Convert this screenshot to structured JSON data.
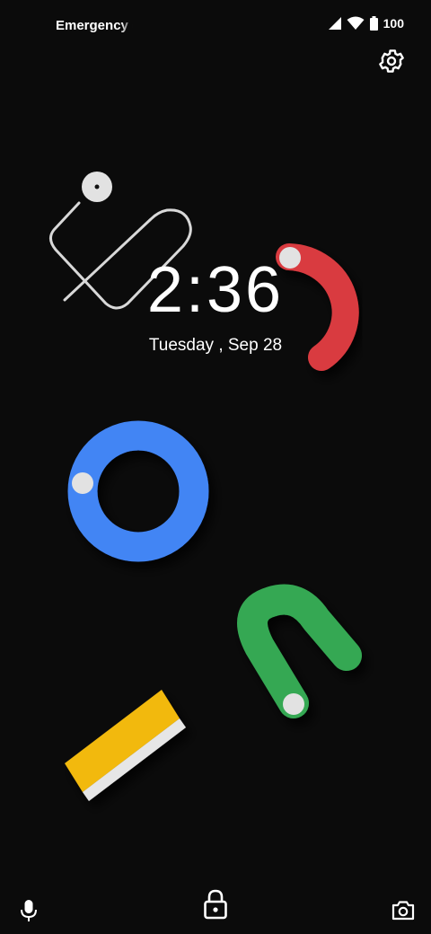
{
  "status_bar": {
    "carrier_text": "Emergency calls only",
    "battery_level": "100",
    "icons": [
      "signal-icon",
      "wifi-icon",
      "battery-icon"
    ]
  },
  "lockscreen": {
    "time": "2:36",
    "date": "Tuesday , Sep 28"
  },
  "shortcuts": {
    "left": "mic-icon",
    "center": "lock-icon",
    "right": "camera-icon"
  },
  "wallpaper": {
    "colors": {
      "red": "#d93a3f",
      "blue": "#4285f4",
      "green": "#34a853",
      "yellow": "#f2b90f",
      "dot": "#e2e2e2",
      "line": "#d8d8d8"
    }
  }
}
